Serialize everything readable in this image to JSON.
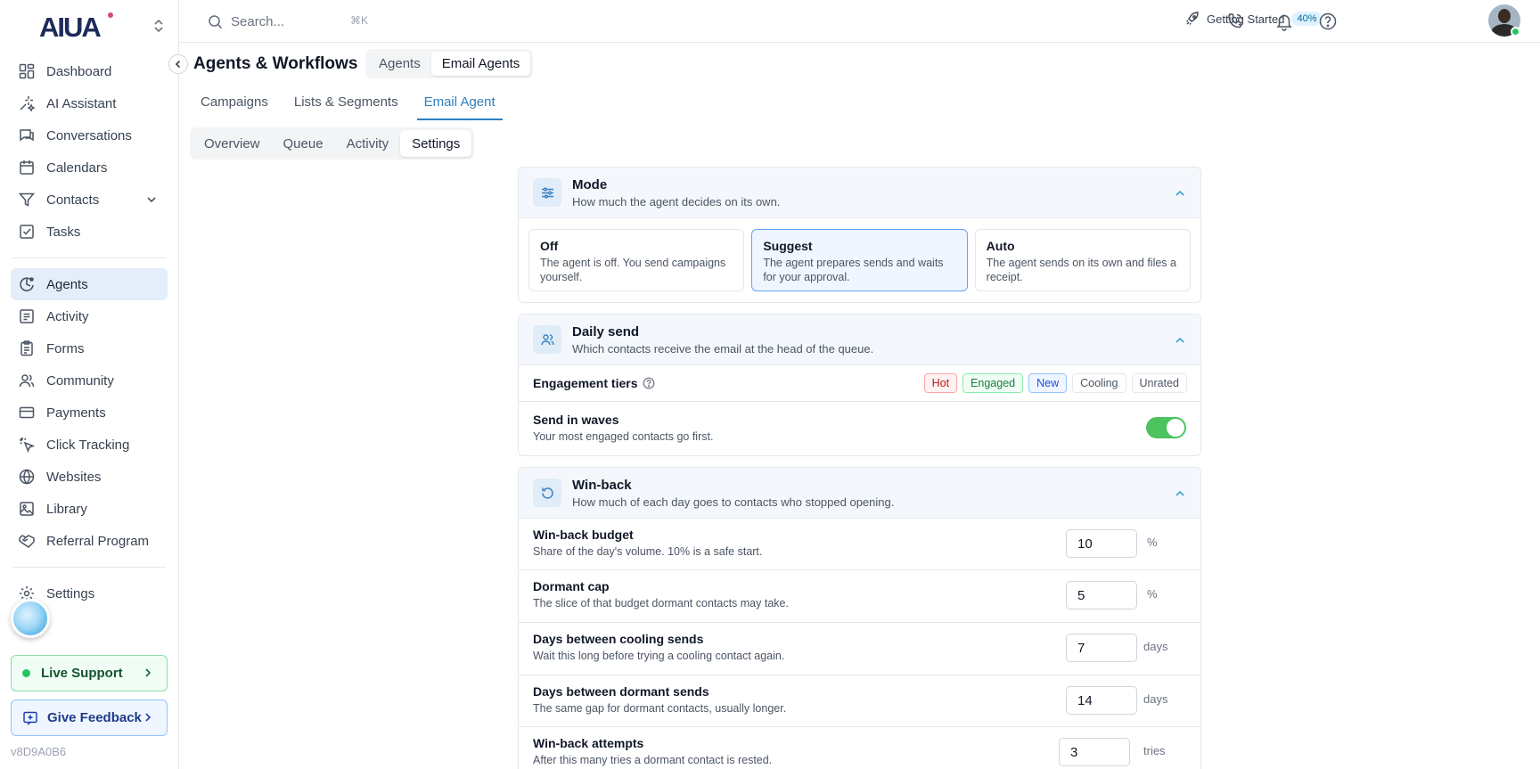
{
  "brand": {
    "logo_text": "AIUA"
  },
  "sidebar": {
    "items_top": [
      {
        "label": "Dashboard",
        "icon": "grid-icon"
      },
      {
        "label": "AI Assistant",
        "icon": "sparkle-icon"
      },
      {
        "label": "Conversations",
        "icon": "chat-icon"
      },
      {
        "label": "Calendars",
        "icon": "calendar-icon"
      },
      {
        "label": "Contacts",
        "icon": "funnel-icon"
      },
      {
        "label": "Tasks",
        "icon": "checkbox-icon"
      }
    ],
    "items_mid": [
      {
        "label": "Agents",
        "icon": "agents-icon"
      },
      {
        "label": "Activity",
        "icon": "list-icon"
      },
      {
        "label": "Forms",
        "icon": "clipboard-icon"
      },
      {
        "label": "Community",
        "icon": "users-icon"
      },
      {
        "label": "Payments",
        "icon": "card-icon"
      },
      {
        "label": "Click Tracking",
        "icon": "cursor-icon"
      },
      {
        "label": "Websites",
        "icon": "globe-icon"
      },
      {
        "label": "Library",
        "icon": "image-icon"
      },
      {
        "label": "Referral Program",
        "icon": "handshake-icon"
      }
    ],
    "settings": "Settings",
    "live_support": "Live Support",
    "give_feedback": "Give Feedback",
    "version": "v8D9A0B6"
  },
  "topbar": {
    "search_placeholder": "Search...",
    "shortcut": "⌘K",
    "getting_started": "Getting Started",
    "progress": "40%"
  },
  "page": {
    "title": "Agents & Workflows",
    "segments": [
      "Agents",
      "Email Agents"
    ],
    "tabs": [
      "Campaigns",
      "Lists & Segments",
      "Email Agent"
    ],
    "subtabs": [
      "Overview",
      "Queue",
      "Activity",
      "Settings"
    ]
  },
  "mode": {
    "title": "Mode",
    "subtitle": "How much the agent decides on its own.",
    "options": [
      {
        "title": "Off",
        "desc": "The agent is off. You send campaigns yourself."
      },
      {
        "title": "Suggest",
        "desc": "The agent prepares sends and waits for your approval."
      },
      {
        "title": "Auto",
        "desc": "The agent sends on its own and files a receipt."
      }
    ],
    "selected": "Suggest"
  },
  "daily": {
    "title": "Daily send",
    "subtitle": "Which contacts receive the email at the head of the queue.",
    "tiers_label": "Engagement tiers",
    "tiers": [
      "Hot",
      "Engaged",
      "New",
      "Cooling",
      "Unrated"
    ],
    "waves_label": "Send in waves",
    "waves_desc": "Your most engaged contacts go first.",
    "waves_on": true
  },
  "winback": {
    "title": "Win-back",
    "subtitle": "How much of each day goes to contacts who stopped opening.",
    "rows": [
      {
        "label": "Win-back budget",
        "desc": "Share of the day's volume. 10% is a safe start.",
        "value": "10",
        "unit": "%"
      },
      {
        "label": "Dormant cap",
        "desc": "The slice of that budget dormant contacts may take.",
        "value": "5",
        "unit": "%"
      },
      {
        "label": "Days between cooling sends",
        "desc": "Wait this long before trying a cooling contact again.",
        "value": "7",
        "unit": "days"
      },
      {
        "label": "Days between dormant sends",
        "desc": "The same gap for dormant contacts, usually longer.",
        "value": "14",
        "unit": "days"
      },
      {
        "label": "Win-back attempts",
        "desc": "After this many tries a dormant contact is rested.",
        "value": "3",
        "unit": "tries"
      }
    ]
  }
}
